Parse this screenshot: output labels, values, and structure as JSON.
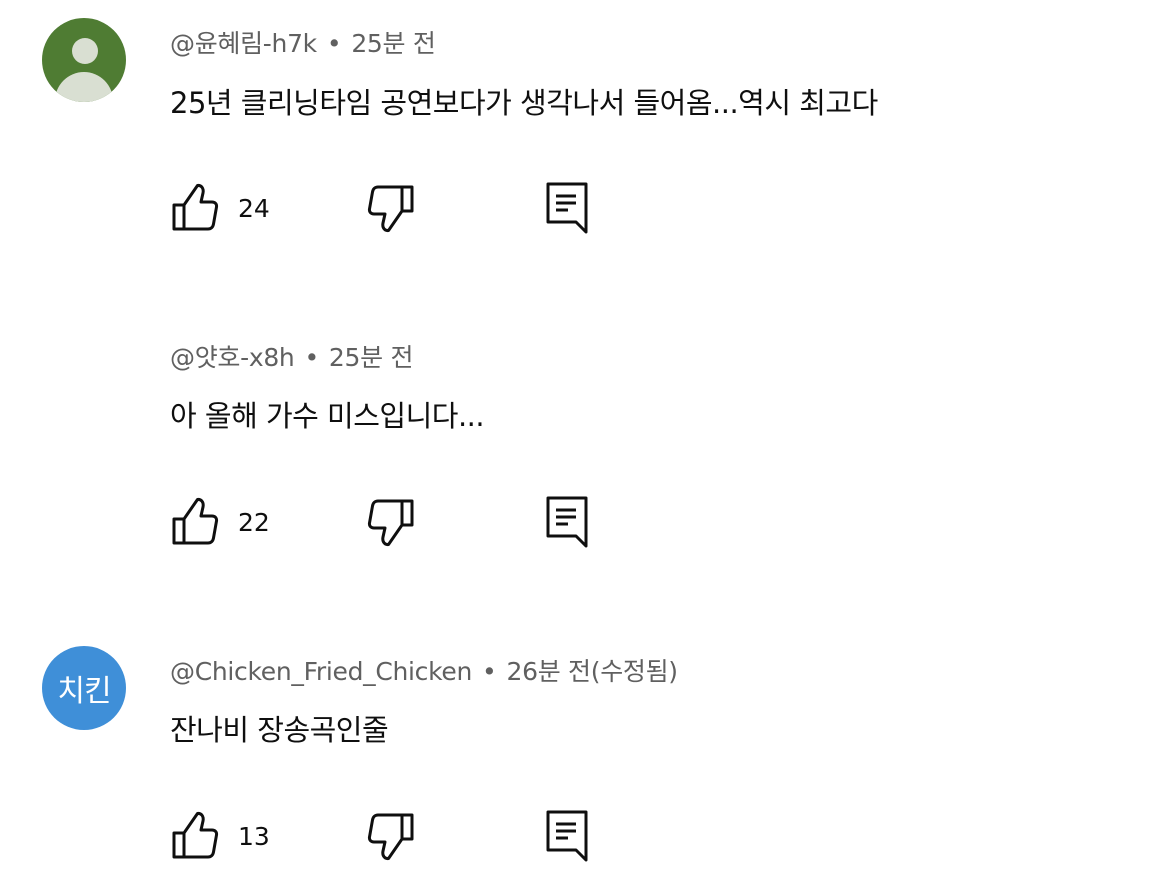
{
  "comments": [
    {
      "author": "@윤혜림-h7k",
      "separator": "•",
      "time": "25분 전",
      "text": "25년 클리닝타임 공연보다가 생각나서 들어옴...역시 최고다",
      "likes": "24",
      "avatar": {
        "type": "default-user-icon",
        "color": "#4f7c33"
      }
    },
    {
      "author": "@얏호-x8h",
      "separator": "•",
      "time": "25분 전",
      "text": "아 올해 가수 미스입니다...",
      "likes": "22",
      "avatar": null
    },
    {
      "author": "@Chicken_Fried_Chicken",
      "separator": "•",
      "time": "26분 전(수정됨)",
      "text": "잔나비 장송곡인줄",
      "likes": "13",
      "avatar": {
        "type": "text",
        "label": "치킨",
        "color": "#3f8fd8"
      }
    }
  ],
  "icons": {
    "like": "thumbs-up-icon",
    "dislike": "thumbs-down-icon",
    "reply": "comment-reply-icon"
  }
}
